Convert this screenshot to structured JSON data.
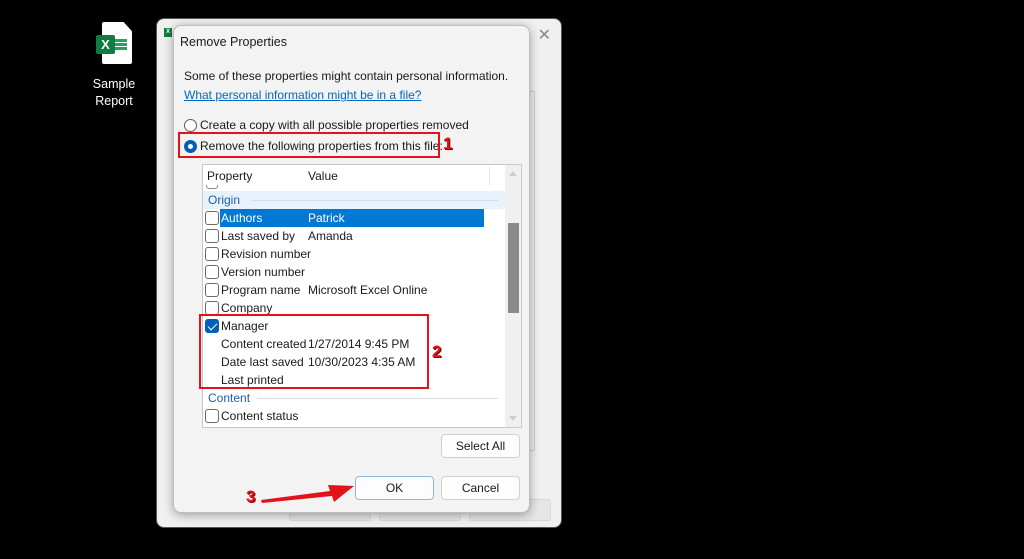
{
  "desktop": {
    "icon_label_line1": "Sample",
    "icon_label_line2": "Report",
    "icon_glyph": "X"
  },
  "background_window": {
    "app_icon": "X",
    "close_glyph": "✕"
  },
  "dialog": {
    "title": "Remove Properties",
    "intro": "Some of these properties might contain personal information.",
    "link": "What personal information might be in a file?",
    "options": [
      {
        "label": "Create a copy with all possible properties removed",
        "selected": false
      },
      {
        "label": "Remove the following properties from this file:",
        "selected": true
      }
    ],
    "list": {
      "headers": {
        "property": "Property",
        "value": "Value"
      },
      "groups": [
        {
          "name": "Origin",
          "items": [
            {
              "property": "Authors",
              "value": "Patrick",
              "checkbox": true,
              "checked": false,
              "selected": true
            },
            {
              "property": "Last saved by",
              "value": "Amanda",
              "checkbox": true,
              "checked": false
            },
            {
              "property": "Revision number",
              "value": "",
              "checkbox": true,
              "checked": false
            },
            {
              "property": "Version number",
              "value": "",
              "checkbox": true,
              "checked": false
            },
            {
              "property": "Program name",
              "value": "Microsoft Excel Online",
              "checkbox": true,
              "checked": false
            },
            {
              "property": "Company",
              "value": "",
              "checkbox": true,
              "checked": false
            },
            {
              "property": "Manager",
              "value": "",
              "checkbox": true,
              "checked": true
            },
            {
              "property": "Content created",
              "value": "1/27/2014 9:45 PM",
              "checkbox": false
            },
            {
              "property": "Date last saved",
              "value": "10/30/2023 4:35 AM",
              "checkbox": false
            },
            {
              "property": "Last printed",
              "value": "",
              "checkbox": false
            }
          ]
        },
        {
          "name": "Content",
          "items": [
            {
              "property": "Content status",
              "value": "",
              "checkbox": true,
              "checked": false
            }
          ]
        }
      ]
    },
    "select_all_label": "Select All",
    "ok_label": "OK",
    "cancel_label": "Cancel"
  },
  "annotations": {
    "step1": "1",
    "step2": "2",
    "step3": "3",
    "color": "#e3131a"
  }
}
